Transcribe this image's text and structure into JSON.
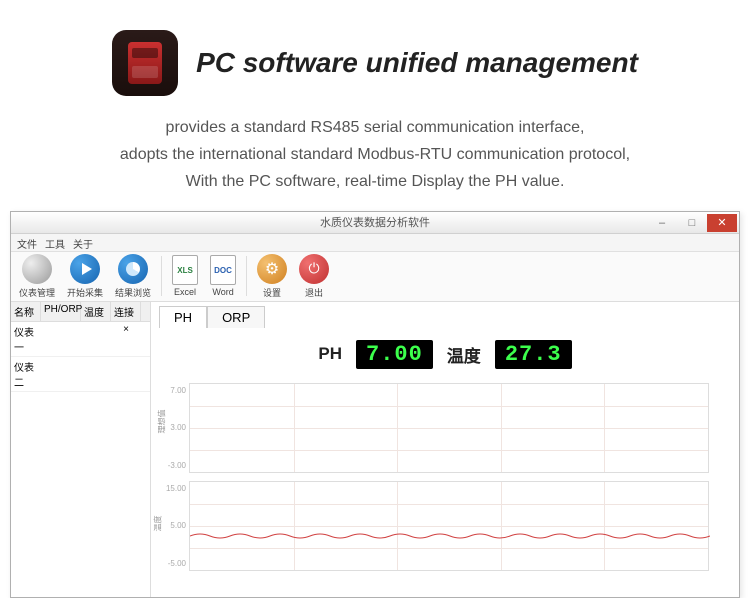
{
  "header": {
    "title": "PC software unified management",
    "desc_line1": "provides a standard RS485 serial communication interface,",
    "desc_line2": "adopts the international standard Modbus-RTU communication protocol,",
    "desc_line3": "With the PC software, real-time Display the PH value."
  },
  "window": {
    "title": "水质仪表数据分析软件"
  },
  "menu": {
    "file": "文件",
    "tools": "工具",
    "about": "关于"
  },
  "toolbar": {
    "instrument": "仪表管理",
    "start": "开始采集",
    "view": "结果浏览",
    "excel_icon": "XLS",
    "excel": "Excel",
    "word_icon": "DOC",
    "word": "Word",
    "settings": "设置",
    "exit": "退出"
  },
  "sidebar": {
    "cols": {
      "name": "名称",
      "phorp": "PH/ORP",
      "temp": "温度",
      "conn": "连接"
    },
    "rows": [
      {
        "name": "仪表一",
        "conn": "×"
      },
      {
        "name": "仪表二"
      }
    ]
  },
  "tabs": {
    "ph": "PH",
    "orp": "ORP"
  },
  "readouts": {
    "ph_label": "PH",
    "ph_value": "7.00",
    "temp_label": "温度",
    "temp_value": "27.3"
  },
  "chart_data": [
    {
      "type": "line",
      "title": "",
      "ylabel": "理想值",
      "ylim": [
        -3,
        7
      ],
      "y_ticks": [
        "7.00",
        "3.00",
        "-3.00"
      ],
      "series": [
        {
          "name": "PH",
          "values": []
        }
      ]
    },
    {
      "type": "line",
      "title": "",
      "ylabel": "温度",
      "ylim": [
        -5,
        15
      ],
      "y_ticks": [
        "15.00",
        "5.00",
        "-5.00"
      ],
      "series": [
        {
          "name": "温度",
          "values": [
            5,
            5.3,
            4.8,
            5.2,
            4.9,
            5.1,
            4.8,
            5.2,
            5,
            5.1,
            4.9,
            5.2,
            4.8,
            5.1,
            5
          ]
        }
      ]
    }
  ]
}
